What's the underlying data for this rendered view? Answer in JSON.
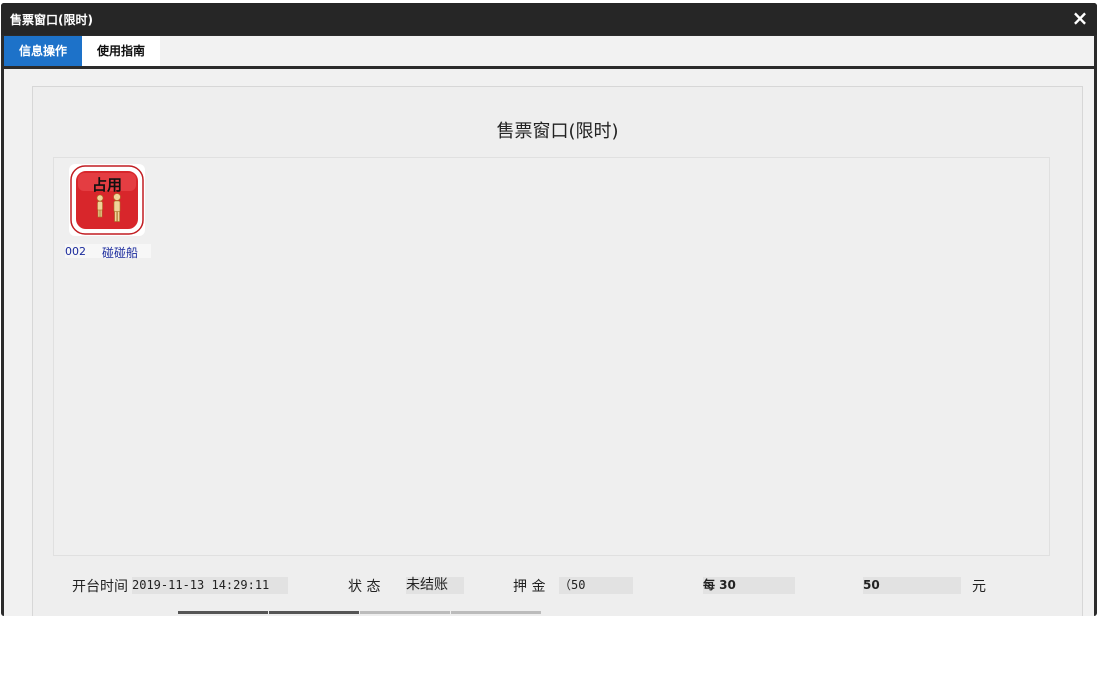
{
  "window": {
    "title": "售票窗口(限时)",
    "close_icon": "×"
  },
  "tabs": [
    {
      "label": "信息操作",
      "active": true
    },
    {
      "label": "使用指南",
      "active": false
    }
  ],
  "panel": {
    "title": "售票窗口(限时)"
  },
  "tables": [
    {
      "badge": "占用",
      "number": "002",
      "name": "碰碰船",
      "status_color": "#d8262b",
      "icon": "people-icon"
    }
  ],
  "info": {
    "open_time_label": "开台时间",
    "open_time_value": "2019-11-13 14:29:11",
    "status_label": "状 态",
    "status_value": "未结账",
    "deposit_label": "押 金",
    "deposit_value": "（50",
    "per_value": "每 30",
    "amount_value": "50",
    "unit": "元"
  },
  "colors": {
    "accent": "#1d72c9",
    "titlebar": "#262626"
  }
}
